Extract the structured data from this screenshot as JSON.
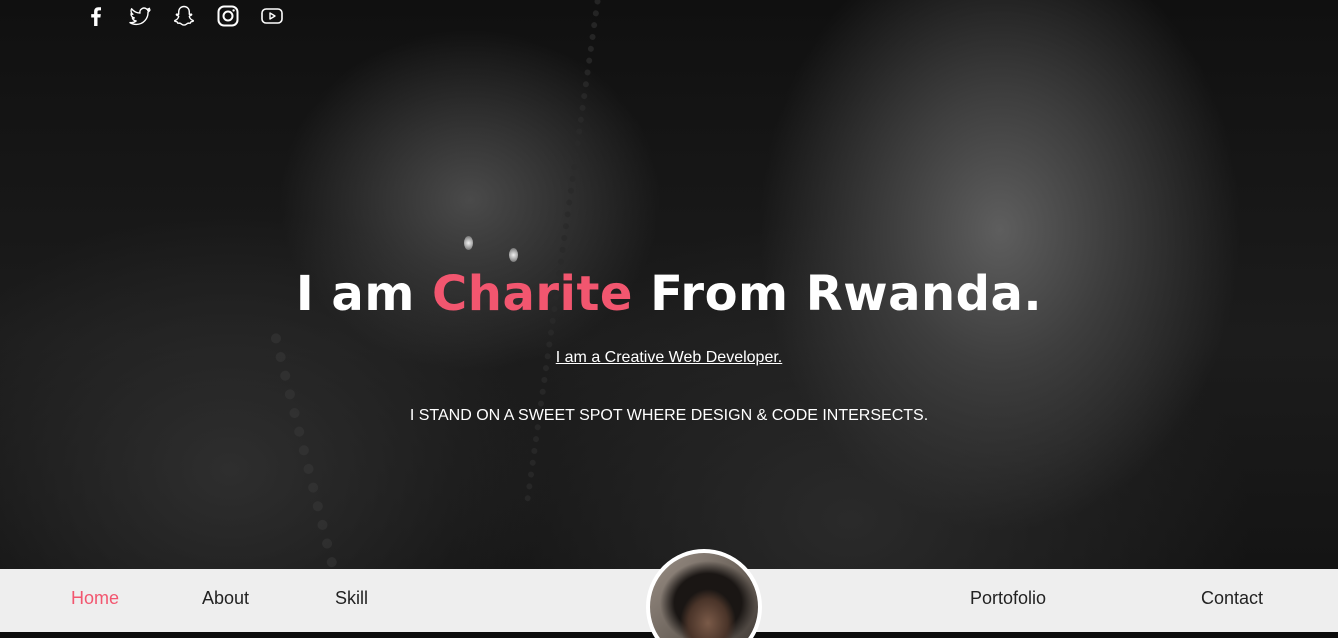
{
  "social": {
    "icons": [
      "facebook-icon",
      "twitter-icon",
      "snapchat-icon",
      "instagram-icon",
      "youtube-icon"
    ]
  },
  "hero": {
    "title_prefix": "I am ",
    "title_name": "Charite",
    "title_suffix": " From Rwanda.",
    "subtitle": "I am a Creative Web Developer.",
    "tagline": "I STAND ON A SWEET SPOT WHERE DESIGN & CODE INTERSECTS."
  },
  "nav": {
    "home": "Home",
    "about": "About",
    "skill": "Skill",
    "portfolio": "Portofolio",
    "contact": "Contact",
    "active": "home"
  },
  "colors": {
    "accent": "#f2566f",
    "nav_bg": "#eeeeee",
    "text_light": "#ffffff",
    "nav_text": "#222222"
  }
}
